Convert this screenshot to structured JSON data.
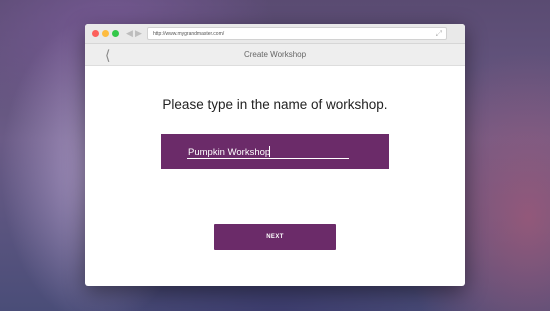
{
  "browser": {
    "url": "http://www.mygrandmaster.com/",
    "buttons": {
      "close": "close",
      "minimize": "minimize",
      "maximize": "maximize"
    },
    "icons": {
      "back": "arrow-left-icon",
      "forward": "arrow-right-icon",
      "expand": "expand-icon"
    }
  },
  "app_bar": {
    "title": "Create Workshop",
    "back_icon": "chevron-left-icon"
  },
  "form": {
    "prompt": "Please type in the name of workshop.",
    "workshop_name_value": "Pumpkin Workshop",
    "next_label": "NEXT"
  },
  "colors": {
    "accent": "#6b2b69",
    "app_bar": "#eeeeee",
    "chrome": "#e9e9e9"
  }
}
